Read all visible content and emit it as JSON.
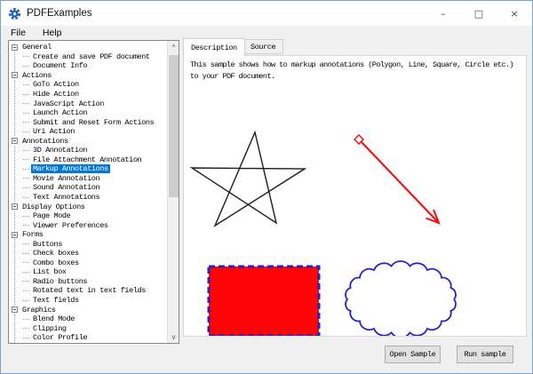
{
  "window": {
    "title": "PDFExamples",
    "controls": {
      "minimize": "–",
      "maximize": "□",
      "close": "×"
    }
  },
  "menu": {
    "items": [
      {
        "label": "File"
      },
      {
        "label": "Help"
      }
    ]
  },
  "tree": {
    "selected": "Markup Annotations",
    "sections": [
      {
        "label": "General",
        "children": [
          "Create and save PDF document",
          "Document Info"
        ]
      },
      {
        "label": "Actions",
        "children": [
          "GoTo Action",
          "Hide Action",
          "JavaScript Action",
          "Launch Action",
          "Submit and Reset Form Actions",
          "Uri Action"
        ]
      },
      {
        "label": "Annotations",
        "children": [
          "3D Annotation",
          "File Attachment Annotation",
          "Markup Annotations",
          "Movie Annotation",
          "Sound Annotation",
          "Text Annotations"
        ]
      },
      {
        "label": "Display Options",
        "children": [
          "Page Mode",
          "Viewer Preferences"
        ]
      },
      {
        "label": "Forms",
        "children": [
          "Buttons",
          "Check boxes",
          "Combo boxes",
          "List box",
          "Radio buttons",
          "Rotated text in text fields",
          "Text fields"
        ]
      },
      {
        "label": "Graphics",
        "children": [
          "Blend Mode",
          "Clipping",
          "Color Profile"
        ]
      }
    ],
    "scrollbar": {
      "up_icon": "^",
      "down_icon": "v"
    }
  },
  "tabs": [
    {
      "label": "Description",
      "active": true
    },
    {
      "label": "Source",
      "active": false
    }
  ],
  "description": {
    "line1": "This sample shows how to markup annotations (Polygon, Line, Square, Circle etc.)",
    "line2": "to your PDF document."
  },
  "canvas": {
    "shapes": [
      "polygon-star",
      "line-arrow",
      "square",
      "circle-cloud"
    ],
    "colors": {
      "star_stroke": "#1c1c1c",
      "annotation_red": "#f40b0b",
      "annotation_blue": "#2222cc",
      "square_fill": "#fb0505"
    }
  },
  "footer": {
    "open_button": "Open Sample",
    "run_button": "Run sample"
  },
  "colors": {
    "selection": "#0078d7",
    "titlebar": "#ffffff",
    "chrome": "#f0f0f0"
  }
}
